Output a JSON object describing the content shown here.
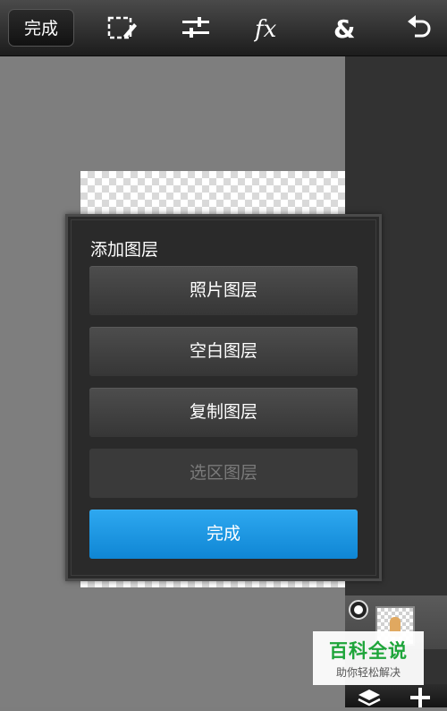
{
  "toolbar": {
    "done_label": "完成",
    "icons": [
      "selection-edit-icon",
      "adjustments-icon",
      "effects-fx-icon",
      "blend-ampersand-icon",
      "undo-icon"
    ]
  },
  "dialog": {
    "title": "添加图层",
    "buttons": [
      {
        "label": "照片图层",
        "enabled": true
      },
      {
        "label": "空白图层",
        "enabled": true
      },
      {
        "label": "复制图层",
        "enabled": true
      },
      {
        "label": "选区图层",
        "enabled": false
      }
    ],
    "confirm_label": "完成"
  },
  "side_panel": {
    "icons": [
      "layers-icon",
      "add-icon"
    ]
  },
  "watermark": {
    "title": "百科全说",
    "subtitle": "助你轻松解决"
  },
  "colors": {
    "accent": "#1a95e0",
    "watermark_green": "#1ea53a"
  }
}
